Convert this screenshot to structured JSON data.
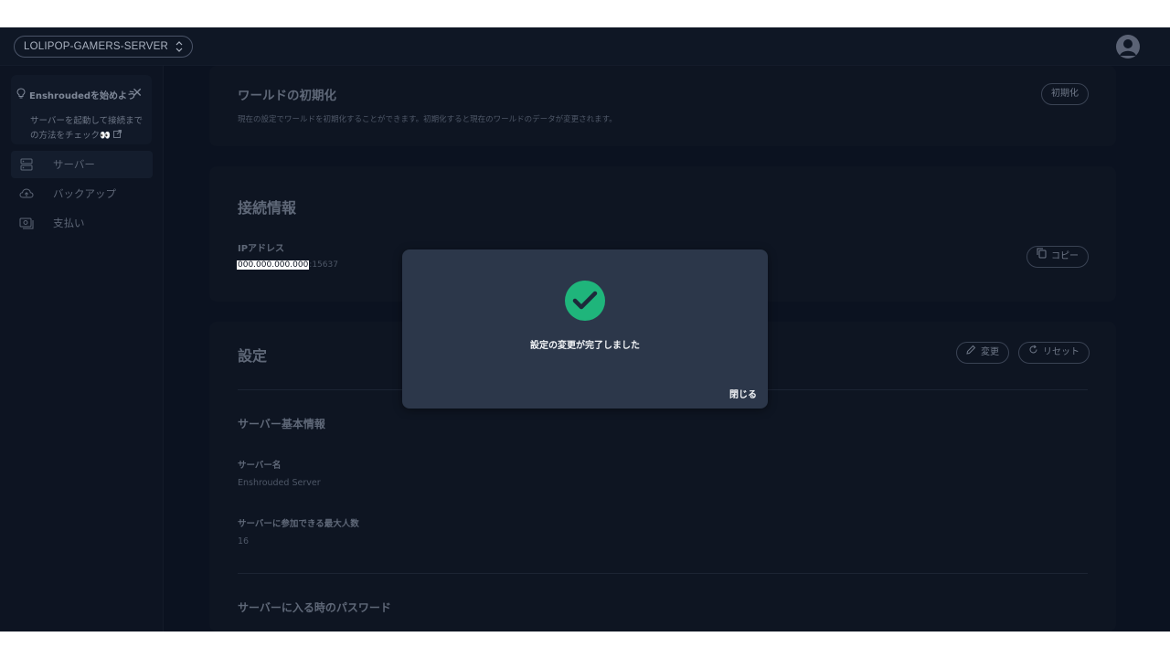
{
  "topbar": {
    "server_name": "LOLIPOP-GAMERS-SERVER",
    "selector_icon": "chevron-updown-icon",
    "avatar_icon": "user-avatar-icon"
  },
  "sidebar": {
    "guide": {
      "title": "Enshroudedを始めよう",
      "text": "サーバーを起動して接続までの方法をチェック",
      "emoji": "👀",
      "icon": "lightbulb-icon"
    },
    "items": [
      {
        "label": "サーバー",
        "icon": "server-icon",
        "active": true
      },
      {
        "label": "バックアップ",
        "icon": "cloud-upload-icon",
        "active": false
      },
      {
        "label": "支払い",
        "icon": "payment-icon",
        "active": false
      }
    ]
  },
  "world_reset": {
    "title": "ワールドの初期化",
    "description": "現在の設定でワールドを初期化することができます。初期化すると現在のワールドのデータが変更されます。",
    "button": "初期化"
  },
  "connection": {
    "title": "接続情報",
    "ip_label": "IPアドレス",
    "ip_address": "000.000.000.000",
    "port": ":15637",
    "copy_button": "コピー"
  },
  "settings": {
    "title": "設定",
    "edit_button": "変更",
    "reset_button": "リセット",
    "basic_title": "サーバー基本情報",
    "server_name_label": "サーバー名",
    "server_name_value": "Enshrouded Server",
    "max_players_label": "サーバーに参加できる最大人数",
    "max_players_value": "16",
    "password_title": "サーバーに入る時のパスワード"
  },
  "modal": {
    "message": "設定の変更が完了しました",
    "close_label": "閉じる",
    "icon": "check-circle-icon",
    "accent": "#1fb57b"
  }
}
